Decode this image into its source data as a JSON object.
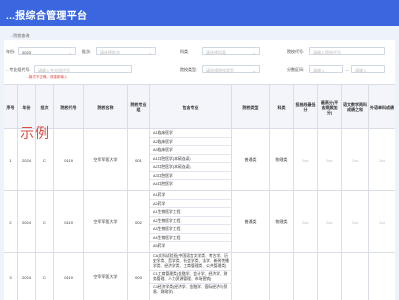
{
  "app": {
    "title": "...报综合管理平台"
  },
  "breadcrumb": "...院校查询",
  "filters": {
    "row1": [
      {
        "label": "年份:",
        "value": "2023",
        "placeholder": ""
      },
      {
        "label": "批次:",
        "value": "",
        "placeholder": "请选择批次"
      },
      {
        "label": "科类:",
        "value": "",
        "placeholder": "请选择科类"
      },
      {
        "label": "院校代号:",
        "value": "",
        "placeholder": "请输入院校代号"
      }
    ],
    "row2": [
      {
        "label": "...专业组代号:",
        "value": "",
        "placeholder": "请输入专业组代号"
      },
      {
        "label": "院校类型:",
        "value": "",
        "placeholder": "请选择院校类型"
      },
      {
        "label": "分数区间:",
        "value": "",
        "placeholder": "请输入"
      }
    ],
    "range_separator": "—",
    "range_end_placeholder": "请输入",
    "warning": "...格式不正确，请重新输入"
  },
  "table": {
    "headers": [
      "序号",
      "年份",
      "批次",
      "院校代号",
      "院校名称",
      "院校专业组",
      "包含专业",
      "院校类型",
      "科类",
      "投档线最低分",
      "最高分(平含照顾加分)",
      "语文数学两科成绩之和",
      "外语单科成绩"
    ],
    "rows": [
      {
        "index": "1",
        "year": "2024",
        "batch": "C",
        "code": "0119",
        "name": "空军军医大学",
        "group": "001",
        "majors": [
          "A1临床医学",
          "A2临床医学",
          "A3临床医学",
          "A1口腔医学(本硕连读)",
          "A2口腔医学(本硕连读)",
          "A3口腔医学",
          "A4口腔医学"
        ],
        "type": "普通类",
        "subject": "物理类",
        "min": "5xx",
        "max": "5xx",
        "chn_math": "1xx",
        "foreign": "1xx"
      },
      {
        "index": "2",
        "year": "2024",
        "batch": "C",
        "code": "0119",
        "name": "空军军医大学",
        "group": "002",
        "majors": [
          "A1药学",
          "A2药学",
          "A1生物医学工程",
          "A2生物医学工程",
          "A3生物医学工程",
          "A4生物医学工程",
          "A5药学"
        ],
        "type": "普通类",
        "subject": "物理类",
        "min": "5xx",
        "max": "5xx",
        "chn_math": "1xx",
        "foreign": "1xx"
      },
      {
        "index": "3",
        "year": "2024",
        "batch": "C",
        "code": "0119",
        "name": "空军军医大学",
        "group": "003",
        "majors": [
          "CA文科试验班(中国语言文学类、考古学、历史学类、哲学类、社会学类、法学、新闻传播学类、经济学类、工商管理类、公共管理类)",
          "C1工商管理类(金融学、会计学、经济学、财务管理、人力资源管理、市场营销)",
          "C4经济学类(经济学、金融学、国际经济与贸易、财政学)"
        ],
        "type": "",
        "subject": "",
        "min": "",
        "max": "",
        "chn_math": "",
        "foreign": ""
      }
    ]
  },
  "watermark": "示例"
}
